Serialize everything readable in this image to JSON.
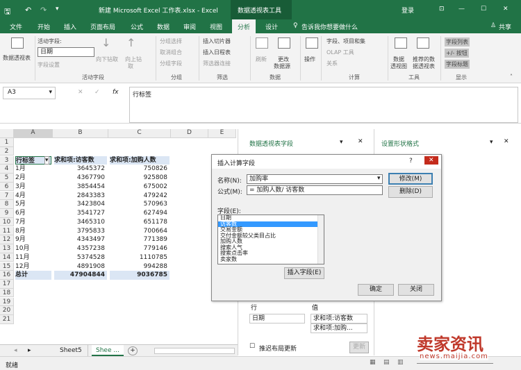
{
  "app": {
    "title": "新建 Microsoft Excel 工作表.xlsx - Excel",
    "context_tab": "数据透视表工具",
    "login": "登录",
    "share": "共享"
  },
  "tabs": [
    "文件",
    "开始",
    "插入",
    "页面布局",
    "公式",
    "数据",
    "审阅",
    "视图",
    "分析",
    "设计"
  ],
  "active_tab": "分析",
  "tellme": "告诉我你想要做什么",
  "ribbon": {
    "pivot": "数据透视表",
    "active_field_label": "活动字段:",
    "active_field_value": "日期",
    "field_settings": "字段设置",
    "drill_down": "向下钻取",
    "drill_up": "向上钻",
    "drill_up2": "取",
    "group_active": "活动字段",
    "grp_sel": "分组选择",
    "ungroup": "取消组合",
    "grp_field": "分组字段",
    "group_group": "分组",
    "slicer": "插入切片器",
    "timeline": "插入日程表",
    "filter_conn": "筛选器连接",
    "group_filter": "筛选",
    "refresh": "刷新",
    "change_src": "更改",
    "change_src2": "数据源",
    "group_data": "数据",
    "actions": "操作",
    "fields_items": "字段、项目和集",
    "olap": "OLAP 工具",
    "relations": "关系",
    "group_calc": "计算",
    "pivotchart": "数据",
    "pivotchart2": "透视图",
    "recommend": "推荐的数",
    "recommend2": "据透视表",
    "group_tools": "工具",
    "field_list": "字段列表",
    "buttons": "+/- 按钮",
    "headers": "字段标题",
    "group_show": "显示"
  },
  "formula": {
    "name_box": "A3",
    "fx": "fx",
    "value": "行标签"
  },
  "columns": [
    "A",
    "B",
    "C",
    "D",
    "E"
  ],
  "rows": [
    "1",
    "2",
    "3",
    "4",
    "5",
    "6",
    "7",
    "8",
    "9",
    "10",
    "11",
    "12",
    "13",
    "14",
    "15",
    "16",
    "17",
    "18",
    "19",
    "20",
    "21"
  ],
  "table": {
    "headers": [
      "行标签",
      "求和项:访客数",
      "求和项:加购人数"
    ],
    "data": [
      [
        "1月",
        "3645372",
        "750826"
      ],
      [
        "2月",
        "4367790",
        "925808"
      ],
      [
        "3月",
        "3854454",
        "675002"
      ],
      [
        "4月",
        "2843383",
        "479242"
      ],
      [
        "5月",
        "3423804",
        "570963"
      ],
      [
        "6月",
        "3541727",
        "627494"
      ],
      [
        "7月",
        "3465310",
        "651178"
      ],
      [
        "8月",
        "3795833",
        "700664"
      ],
      [
        "9月",
        "4343497",
        "771389"
      ],
      [
        "10月",
        "4357238",
        "779146"
      ],
      [
        "11月",
        "5374528",
        "1110785"
      ],
      [
        "12月",
        "4891908",
        "994288"
      ]
    ],
    "total": [
      "总计",
      "47904844",
      "9036785"
    ]
  },
  "pane1": {
    "title": "数据透视表字段",
    "rows_label": "行",
    "values_label": "值",
    "row_field": "日期",
    "val1": "求和项:访客数",
    "val2": "求和项:加购...",
    "defer": "推迟布局更新",
    "update": "更新"
  },
  "pane2": {
    "title": "设置形状格式"
  },
  "dialog": {
    "title": "插入计算字段",
    "help": "?",
    "close": "✕",
    "name_label": "名称(N):",
    "name_value": "加购率",
    "formula_label": "公式(M):",
    "formula_value": "= 加购人数/ 访客数",
    "modify": "修改(M)",
    "delete": "删除(D)",
    "fields_label": "字段(E):",
    "fields": [
      "日期",
      "访客数",
      "交易金额",
      "交付金额较父类目占比",
      "加购人数",
      "搜索人气",
      "搜索点击率",
      "卖家数"
    ],
    "selected_field": 1,
    "insert_field": "插入字段(E)",
    "ok": "确定",
    "cancel": "关闭"
  },
  "sheet_tabs": [
    "Sheet5",
    "Shee ..."
  ],
  "status": "就绪",
  "watermark": "卖家资讯",
  "watermark_url": "news.maijia.com"
}
